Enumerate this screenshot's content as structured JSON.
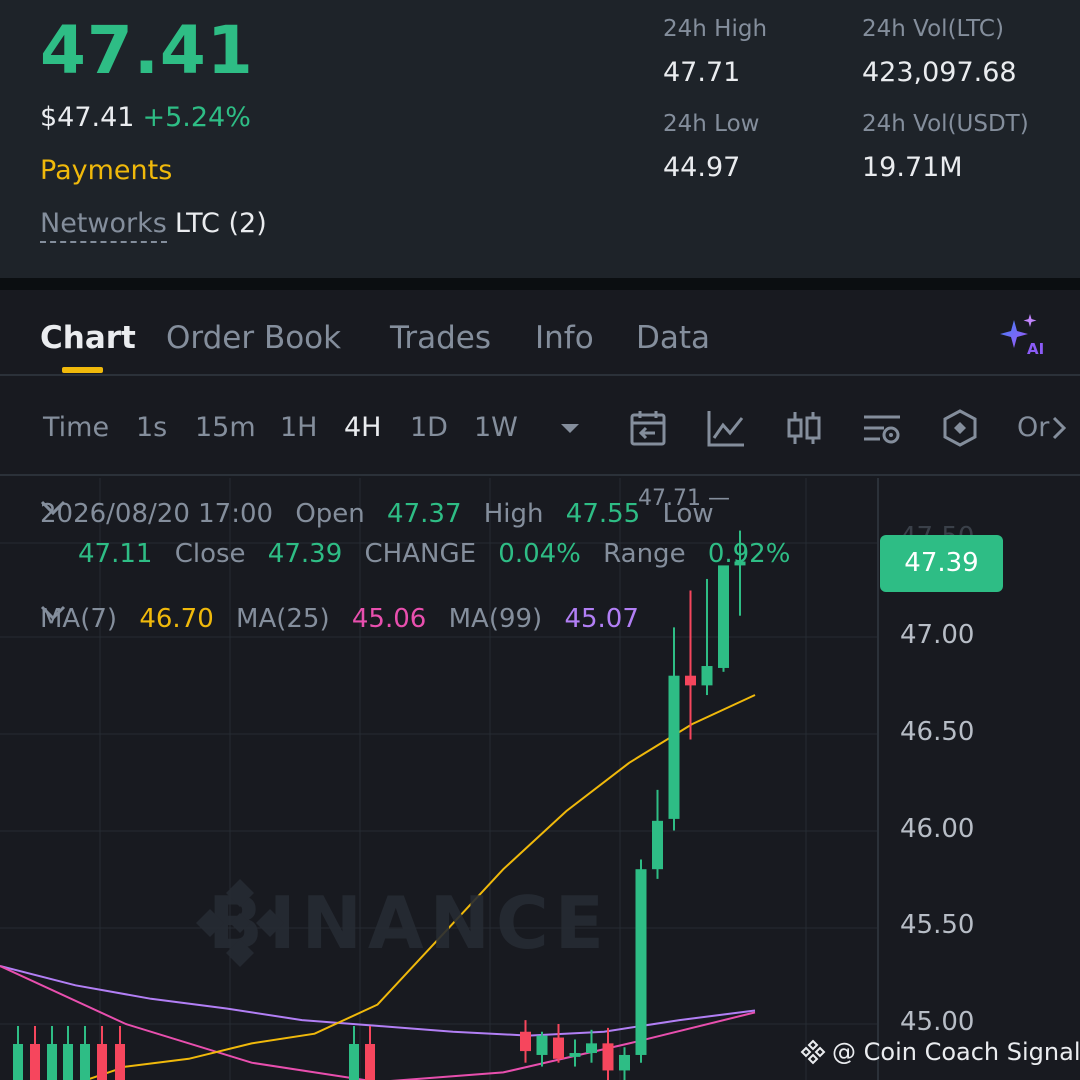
{
  "header": {
    "price": "47.41",
    "price_fiat": "$47.41",
    "price_change": "+5.24%",
    "category": "Payments",
    "networks_label": "Networks",
    "networks_value": "LTC (2)",
    "stats": {
      "high_label": "24h High",
      "high_value": "47.71",
      "low_label": "24h Low",
      "low_value": "44.97",
      "vol_base_label": "24h Vol(LTC)",
      "vol_base_value": "423,097.68",
      "vol_quote_label": "24h Vol(USDT)",
      "vol_quote_value": "19.71M"
    }
  },
  "tabs": [
    "Chart",
    "Order Book",
    "Trades",
    "Info",
    "Data"
  ],
  "active_tab": "Chart",
  "ai_icon": "ai-sparkle-icon",
  "toolbar": {
    "timeframes": [
      "Time",
      "1s",
      "15m",
      "1H",
      "4H",
      "1D",
      "1W"
    ],
    "active_timeframe": "4H",
    "more_label": "Or",
    "icons": [
      "chevron-down-icon",
      "calendar-back-icon",
      "indicator-chart-icon",
      "candle-type-icon",
      "settings-sliders-icon",
      "depth-icon",
      "chevron-right-icon"
    ]
  },
  "ohlc": {
    "datetime": "2026/08/20 17:00",
    "open_label": "Open",
    "open": "47.37",
    "high_label": "High",
    "high": "47.55",
    "low_label": "Low",
    "low": "47.11",
    "close_label": "Close",
    "close": "47.39",
    "change_label": "CHANGE",
    "change": "0.04%",
    "range_label": "Range",
    "range": "0.92%"
  },
  "ma": {
    "ma7_label": "MA(7)",
    "ma7": "46.70",
    "ma25_label": "MA(25)",
    "ma25": "45.06",
    "ma99_label": "MA(99)",
    "ma99": "45.07"
  },
  "chart": {
    "current_price_tag": "47.39",
    "high_marker": "47.71",
    "partial_tick": "47.50",
    "watermark": "BINANCE",
    "colors": {
      "up": "#2ebd85",
      "down": "#f6465d",
      "ma7": "#f0b90b",
      "ma25": "#e84fae",
      "ma99": "#b27ff5"
    }
  },
  "chart_data": {
    "type": "candlestick",
    "interval": "4H",
    "y_ticks": [
      "47.00",
      "46.50",
      "46.00",
      "45.50",
      "45.00"
    ],
    "ylim": [
      44.88,
      47.81
    ],
    "candles": [
      {
        "o": 44.96,
        "h": 45.02,
        "l": 44.8,
        "c": 44.86
      },
      {
        "o": 44.84,
        "h": 44.96,
        "l": 44.78,
        "c": 44.94
      },
      {
        "o": 44.93,
        "h": 45.0,
        "l": 44.8,
        "c": 44.82
      },
      {
        "o": 44.83,
        "h": 44.92,
        "l": 44.78,
        "c": 44.85
      },
      {
        "o": 44.85,
        "h": 44.97,
        "l": 44.8,
        "c": 44.9
      },
      {
        "o": 44.9,
        "h": 44.98,
        "l": 44.7,
        "c": 44.76
      },
      {
        "o": 44.76,
        "h": 44.88,
        "l": 44.6,
        "c": 44.84
      },
      {
        "o": 44.84,
        "h": 45.85,
        "l": 44.8,
        "c": 45.8
      },
      {
        "o": 45.8,
        "h": 46.21,
        "l": 45.75,
        "c": 46.05
      },
      {
        "o": 46.06,
        "h": 47.05,
        "l": 46.0,
        "c": 46.8
      },
      {
        "o": 46.8,
        "h": 47.24,
        "l": 46.47,
        "c": 46.75
      },
      {
        "o": 46.75,
        "h": 47.3,
        "l": 46.7,
        "c": 46.85
      },
      {
        "o": 46.84,
        "h": 47.35,
        "l": 46.82,
        "c": 47.37
      },
      {
        "o": 47.37,
        "h": 47.55,
        "l": 47.11,
        "c": 47.39
      }
    ],
    "ma7": [
      44.6,
      44.67,
      44.78,
      44.82,
      44.9,
      44.95,
      45.1,
      45.45,
      45.8,
      46.1,
      46.35,
      46.55,
      46.7
    ],
    "ma25": [
      45.3,
      45.0,
      44.8,
      44.7,
      44.75,
      44.9,
      45.06
    ],
    "ma99": [
      45.3,
      45.2,
      45.13,
      45.08,
      45.02,
      44.99,
      44.96,
      44.94,
      44.96,
      45.02,
      45.07
    ]
  },
  "credit": "@ Coin Coach Signals"
}
